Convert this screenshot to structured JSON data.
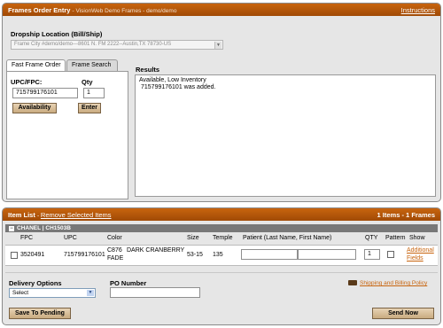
{
  "header": {
    "title": "Frames Order Entry",
    "subtitle": "- VisionWeb Demo Frames - demo/demo",
    "instructions": "Instructions"
  },
  "dropship": {
    "label": "Dropship Location (Bill/Ship)",
    "value": "Frame City #demo/demo---8601 N. FM 2222--Austin,TX 78730-US"
  },
  "tabs": [
    {
      "label": "Fast Frame Order",
      "active": true
    },
    {
      "label": "Frame Search",
      "active": false
    }
  ],
  "fast_order": {
    "upc_label": "UPC/FPC:",
    "qty_label": "Qty",
    "upc_value": "715799176101",
    "qty_value": "1",
    "availability_button": "Availability",
    "enter_button": "Enter"
  },
  "results": {
    "label": "Results",
    "lines": [
      "Available, Low Inventory",
      "715799176101 was added."
    ]
  },
  "item_list": {
    "title": "Item List",
    "remove_link": "Remove Selected Items",
    "summary": "1 Items - 1 Frames",
    "group": "CHANEL | CH1503B",
    "columns": [
      "FPC",
      "UPC",
      "Color",
      "Size",
      "Temple",
      "Patient (Last Name, First Name)",
      "QTY",
      "Pattern",
      "Show"
    ],
    "rows": [
      {
        "fpc": "3520491",
        "upc": "715799176101",
        "color_code": "C876",
        "color_name": "DARK CRANBERRY",
        "color_extra": "FADE",
        "size": "53-15",
        "temple": "135",
        "patient_last": "",
        "patient_first": "",
        "qty": "1",
        "show_link_1": "Additional",
        "show_link_2": "Fields"
      }
    ]
  },
  "delivery": {
    "label": "Delivery Options",
    "selected": "Select"
  },
  "po": {
    "label": "PO Number",
    "value": ""
  },
  "shipping_link": "Shipping and Billing Policy",
  "buttons": {
    "save": "Save To Pending",
    "send": "Send Now"
  },
  "colors": {
    "header_orange": "#b4560a",
    "button_tan": "#d8bf98"
  }
}
